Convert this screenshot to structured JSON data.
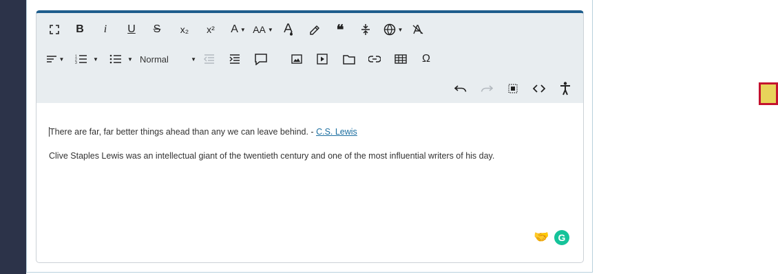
{
  "toolbar": {
    "row1": [
      {
        "name": "fullscreen-icon"
      },
      {
        "name": "bold-button",
        "glyph": "B"
      },
      {
        "name": "italic-button",
        "glyph": "i"
      },
      {
        "name": "underline-button",
        "glyph": "U"
      },
      {
        "name": "strikethrough-button",
        "glyph": "S"
      },
      {
        "name": "subscript-button",
        "glyph": "x₂"
      },
      {
        "name": "superscript-button",
        "glyph": "x²"
      },
      {
        "name": "font-family-button",
        "glyph": "A"
      },
      {
        "name": "font-size-button",
        "glyph": "AA"
      },
      {
        "name": "text-color-icon"
      },
      {
        "name": "highlight-icon"
      },
      {
        "name": "quote-icon",
        "glyph": "❝"
      },
      {
        "name": "page-break-icon"
      },
      {
        "name": "language-icon"
      },
      {
        "name": "clear-formatting-icon"
      }
    ],
    "row2": {
      "paragraph_style": "Normal",
      "items": [
        "align-icon",
        "ordered-list-icon",
        "unordered-list-icon",
        "outdent-icon",
        "indent-icon",
        "comment-icon",
        "image-icon",
        "video-icon",
        "file-manager-icon",
        "link-icon",
        "table-icon",
        "special-character-icon"
      ],
      "special_char_glyph": "Ω"
    },
    "row3": [
      "undo-icon",
      "redo-icon",
      "select-all-icon",
      "source-code-icon",
      "accessibility-icon"
    ]
  },
  "content": {
    "quote_text": "There are far, far better things ahead than any we can leave behind. - ",
    "quote_author_link": "C.S. Lewis",
    "paragraph": "Clive Staples Lewis was an intellectual giant of the twentieth century and one of the most influential writers of his day."
  },
  "widgets": {
    "grammarly_letter": "G",
    "handshake_glyph": "🤝"
  },
  "colors": {
    "left_rail": "#2c3349",
    "toolbar_bg": "#e8edf0",
    "editor_top_border": "#1e5d8c",
    "link": "#1b6ea0",
    "marker_fill": "#e8d35a",
    "marker_border": "#c4122e"
  }
}
